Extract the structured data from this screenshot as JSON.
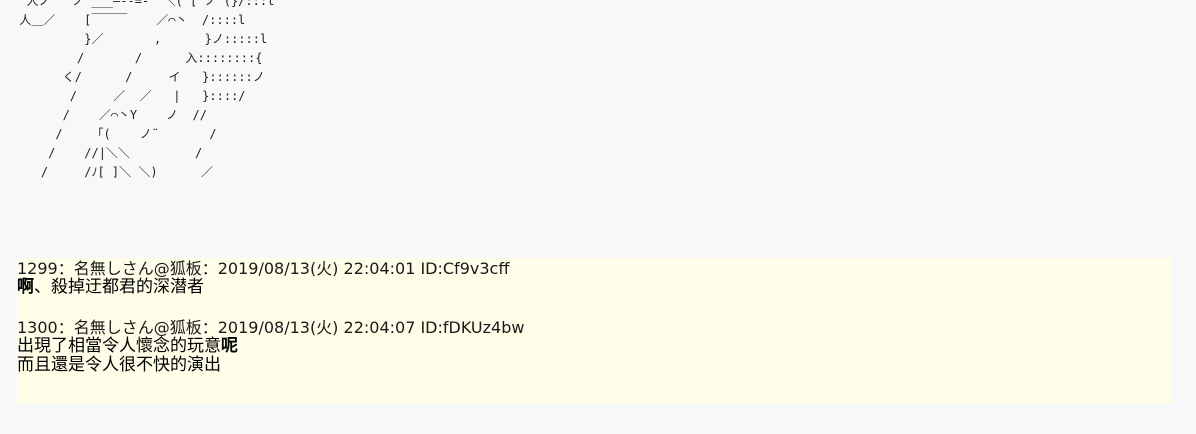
{
  "ascii_art": {
    "lines": [
      "  人ノ   ノ ___―--=-  ＼( [ ノ (}/:::l",
      " 人＿／    [￣￣￣    ／⌒丶  /::::l",
      "          }／       ,      }ノ:::::l",
      "         /       /      入::::::::{",
      "       く/      /     イ   }::::::ノ",
      "        /     ／  ／   |   }::::/",
      "       /    ／⌒丶Y    ノ  //",
      "      /    「(    ノ¨       /",
      "     /    //|＼＼         /",
      "    /     /ﾉ[ ]＼ ＼)      ／"
    ]
  },
  "posts": [
    {
      "header": "1299：名無しさん@狐板：2019/08/13(火) 22:04:01 ID:Cf9v3cff",
      "lines": [
        {
          "text": "啊、殺掉迂都君的深潜者",
          "bold_prefix": "啊"
        }
      ]
    },
    {
      "header": "1300：名無しさん@狐板：2019/08/13(火) 22:04:07 ID:fDKUz4bw",
      "lines": [
        {
          "text": "出現了相當令人懷念的玩意呢",
          "bold_suffix": "呢"
        },
        {
          "text": "而且還是令人很不快的演出"
        }
      ]
    }
  ]
}
